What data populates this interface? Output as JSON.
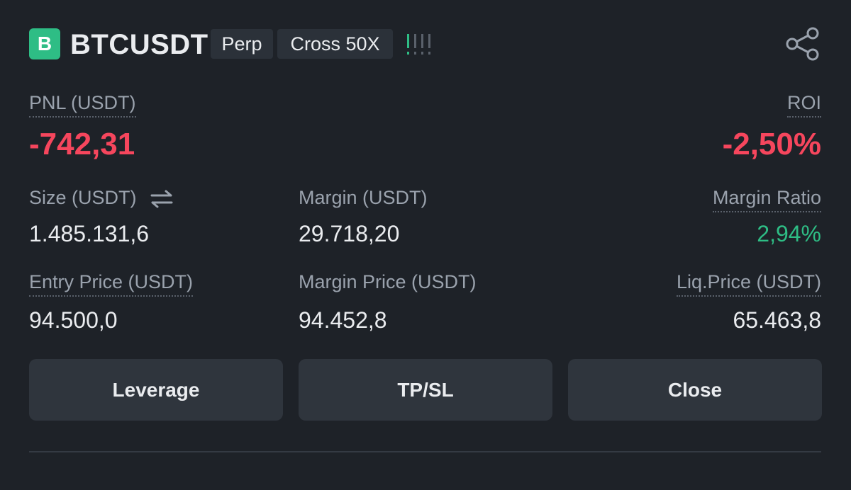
{
  "header": {
    "badge_letter": "B",
    "symbol": "BTCUSDT",
    "type_tag": "Perp",
    "leverage_tag": "Cross 50X",
    "share_icon": "share-icon",
    "strength_icon": "signal-strength-icon"
  },
  "pnl": {
    "label": "PNL (USDT)",
    "value": "-742,31"
  },
  "roi": {
    "label": "ROI",
    "value": "-2,50%"
  },
  "size": {
    "label": "Size (USDT)",
    "value": "1.485.131,6",
    "swap_icon": "swap-arrows-icon"
  },
  "margin": {
    "label": "Margin (USDT)",
    "value": "29.718,20"
  },
  "margin_ratio": {
    "label": "Margin Ratio",
    "value": "2,94%"
  },
  "entry_price": {
    "label": "Entry Price (USDT)",
    "value": "94.500,0"
  },
  "margin_price": {
    "label": "Margin Price (USDT)",
    "value": "94.452,8"
  },
  "liq_price": {
    "label": "Liq.Price (USDT)",
    "value": "65.463,8"
  },
  "buttons": {
    "leverage": "Leverage",
    "tpsl": "TP/SL",
    "close": "Close"
  },
  "colors": {
    "negative": "#f6465d",
    "positive": "#2ebd85",
    "background": "#1e2228"
  }
}
